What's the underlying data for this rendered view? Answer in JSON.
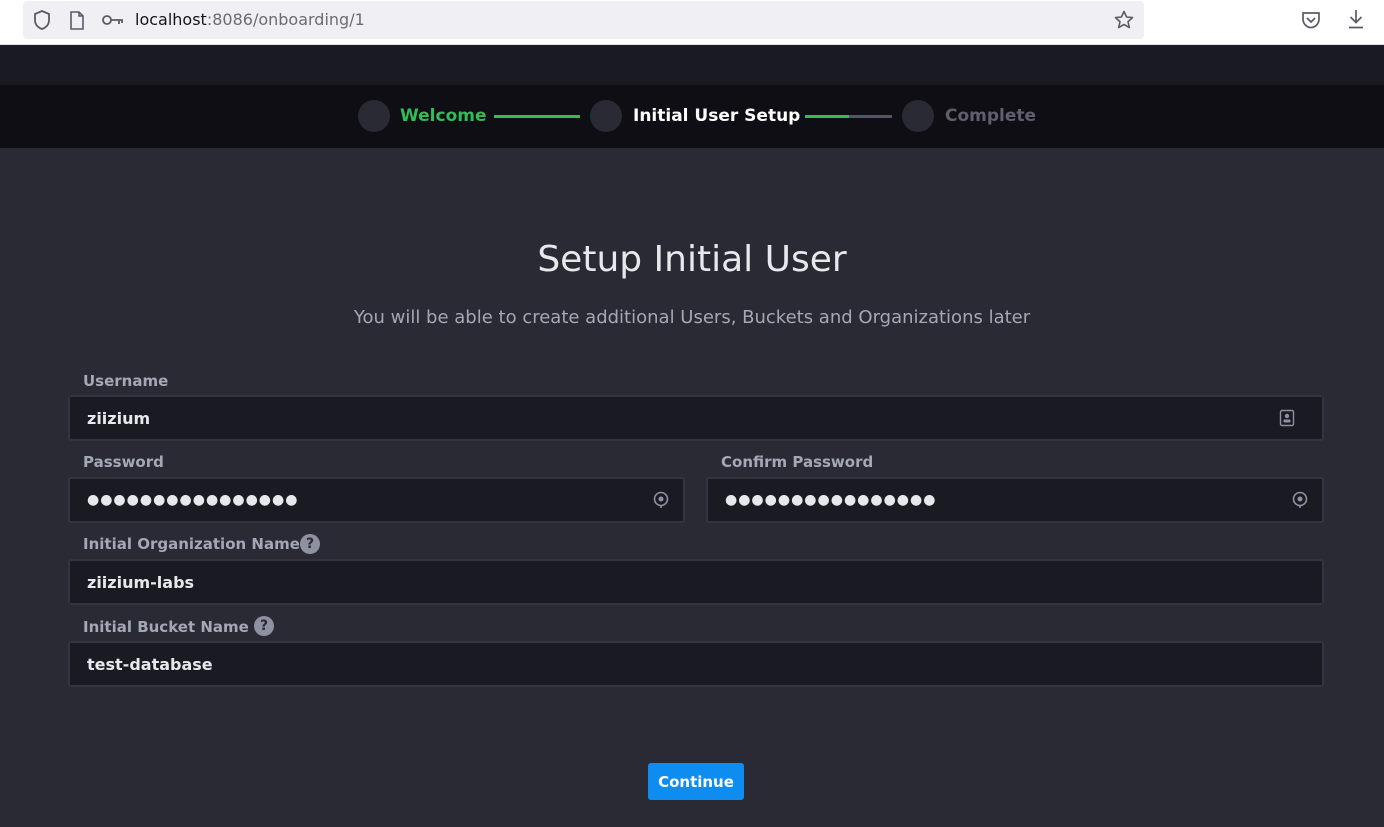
{
  "browser": {
    "url_host": "localhost",
    "url_rest": ":8086/onboarding/1",
    "icons": [
      "shield-icon",
      "page-icon",
      "key-icon",
      "bookmark-star-icon",
      "pocket-icon",
      "download-icon"
    ]
  },
  "stepper": {
    "steps": [
      {
        "label": "Welcome",
        "state": "done"
      },
      {
        "label": "Initial User Setup",
        "state": "current"
      },
      {
        "label": "Complete",
        "state": "pending"
      }
    ],
    "progress_line_1": 1.0,
    "progress_line_2": 0.5
  },
  "main": {
    "title": "Setup Initial User",
    "subtitle": "You will be able to create additional Users, Buckets and Organizations later"
  },
  "form": {
    "username": {
      "label": "Username",
      "value": "ziizium",
      "icon": "contact-card-icon"
    },
    "password": {
      "label": "Password",
      "value": "●●●●●●●●●●●●●●●●",
      "icon": "password-manager-icon"
    },
    "confirm_password": {
      "label": "Confirm Password",
      "value": "●●●●●●●●●●●●●●●●",
      "icon": "password-manager-icon"
    },
    "org_name": {
      "label": "Initial Organization Name",
      "value": "ziizium-labs",
      "help": "?"
    },
    "bucket_name": {
      "label": "Initial Bucket Name",
      "value": "test-database",
      "help": "?"
    },
    "continue_label": "Continue"
  },
  "colors": {
    "accent_green": "#34bb55",
    "primary_blue": "#0e8cf0",
    "background": "#292a33",
    "input_bg": "#1a1a22"
  }
}
